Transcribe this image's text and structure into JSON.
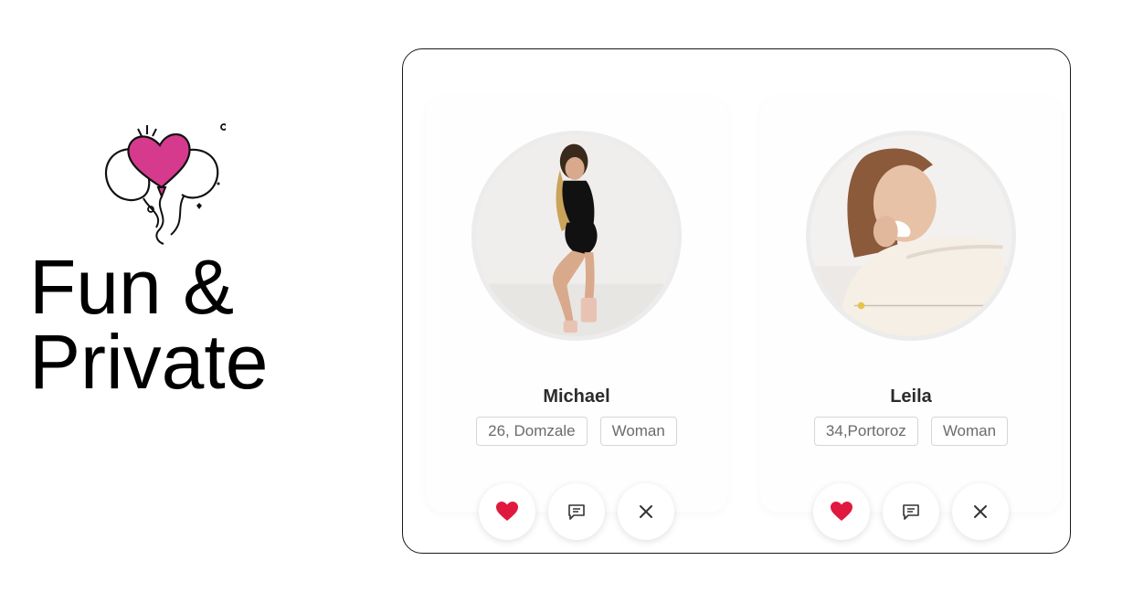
{
  "hero": {
    "headline_line1": "Fun &",
    "headline_line2": "Private"
  },
  "profiles": [
    {
      "name": "Michael",
      "location": "26, Domzale",
      "gender": "Woman"
    },
    {
      "name": "Leila",
      "location": "34,Portoroz",
      "gender": "Woman"
    }
  ],
  "icons": {
    "like": "heart-icon",
    "message": "chat-icon",
    "dismiss": "close-icon",
    "decoration": "heart-balloons-icon"
  },
  "colors": {
    "heart_red": "#e0193f",
    "balloon_pink": "#d63a8c",
    "frame_border": "#1a1a1a"
  }
}
